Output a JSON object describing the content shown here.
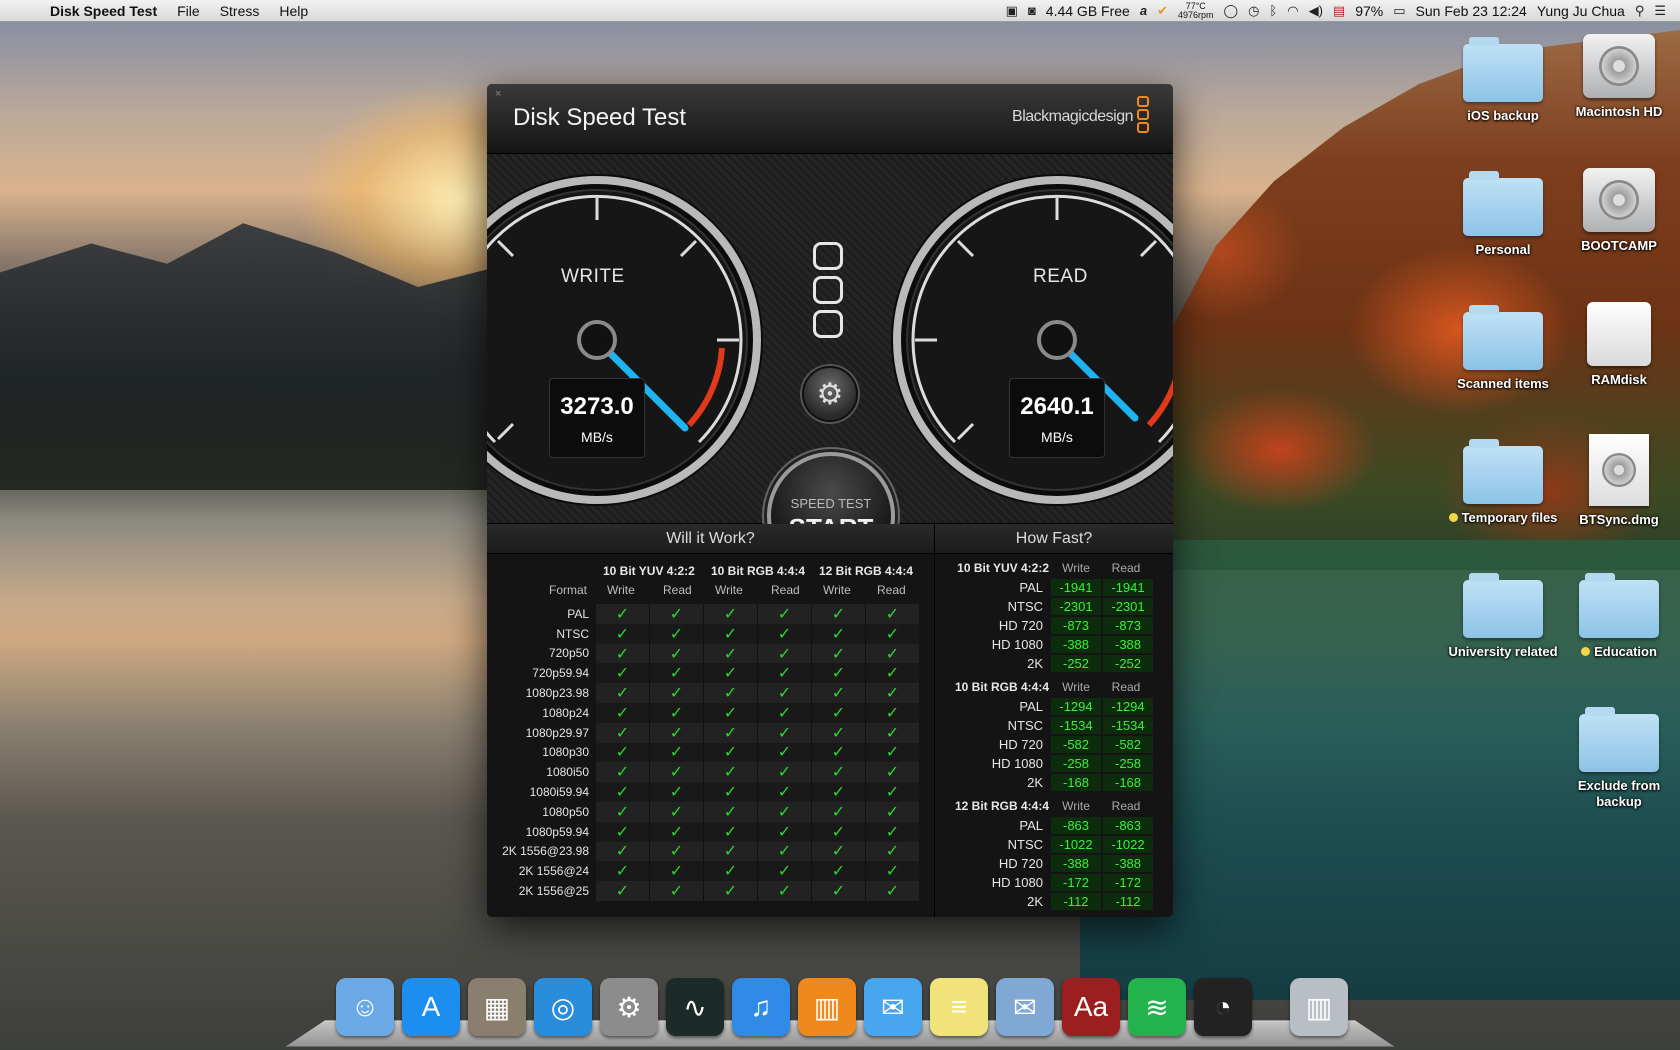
{
  "menubar": {
    "app_name": "Disk Speed Test",
    "menus": [
      "File",
      "Stress",
      "Help"
    ],
    "disk_free": "4.44 GB Free",
    "temp": "77°C",
    "rpm": "4976rpm",
    "battery": "97%",
    "datetime": "Sun Feb 23  12:24",
    "user": "Yung Ju Chua"
  },
  "desktop": {
    "items": [
      {
        "label": "iOS backup",
        "kind": "folder"
      },
      {
        "label": "Macintosh HD",
        "kind": "hdd"
      },
      {
        "label": "Personal",
        "kind": "folder"
      },
      {
        "label": "BOOTCAMP",
        "kind": "hdd"
      },
      {
        "label": "Scanned items",
        "kind": "folder"
      },
      {
        "label": "RAMdisk",
        "kind": "drive"
      },
      {
        "label": "Temporary files",
        "kind": "folder",
        "tag": "yellow"
      },
      {
        "label": "BTSync.dmg",
        "kind": "dmg"
      },
      {
        "label": "University related",
        "kind": "folder"
      },
      {
        "label": "Education",
        "kind": "folder",
        "tag": "yellow"
      },
      {
        "label": "Exclude from backup",
        "kind": "folder"
      }
    ]
  },
  "window": {
    "title": "Disk Speed Test",
    "brand": "Blackmagicdesign",
    "write": {
      "label": "WRITE",
      "value": "3273.0",
      "unit": "MB/s"
    },
    "read": {
      "label": "READ",
      "value": "2640.1",
      "unit": "MB/s"
    },
    "start": {
      "small": "SPEED TEST",
      "big": "START"
    },
    "will_it_work": {
      "title": "Will it Work?",
      "groups": [
        "10 Bit YUV 4:2:2",
        "10 Bit RGB 4:4:4",
        "12 Bit RGB 4:4:4"
      ],
      "format_header": "Format",
      "sub_write": "Write",
      "sub_read": "Read",
      "formats": [
        "PAL",
        "NTSC",
        "720p50",
        "720p59.94",
        "1080p23.98",
        "1080p24",
        "1080p29.97",
        "1080p30",
        "1080i50",
        "1080i59.94",
        "1080p50",
        "1080p59.94",
        "2K 1556@23.98",
        "2K 1556@24",
        "2K 1556@25"
      ],
      "check": "✓"
    },
    "how_fast": {
      "title": "How Fast?",
      "groups": [
        {
          "name": "10 Bit YUV 4:2:2",
          "rows": [
            {
              "fmt": "PAL",
              "w": "-1941",
              "r": "-1941"
            },
            {
              "fmt": "NTSC",
              "w": "-2301",
              "r": "-2301"
            },
            {
              "fmt": "HD 720",
              "w": "-873",
              "r": "-873"
            },
            {
              "fmt": "HD 1080",
              "w": "-388",
              "r": "-388"
            },
            {
              "fmt": "2K",
              "w": "-252",
              "r": "-252"
            }
          ]
        },
        {
          "name": "10 Bit RGB 4:4:4",
          "rows": [
            {
              "fmt": "PAL",
              "w": "-1294",
              "r": "-1294"
            },
            {
              "fmt": "NTSC",
              "w": "-1534",
              "r": "-1534"
            },
            {
              "fmt": "HD 720",
              "w": "-582",
              "r": "-582"
            },
            {
              "fmt": "HD 1080",
              "w": "-258",
              "r": "-258"
            },
            {
              "fmt": "2K",
              "w": "-168",
              "r": "-168"
            }
          ]
        },
        {
          "name": "12 Bit RGB 4:4:4",
          "rows": [
            {
              "fmt": "PAL",
              "w": "-863",
              "r": "-863"
            },
            {
              "fmt": "NTSC",
              "w": "-1022",
              "r": "-1022"
            },
            {
              "fmt": "HD 720",
              "w": "-388",
              "r": "-388"
            },
            {
              "fmt": "HD 1080",
              "w": "-172",
              "r": "-172"
            },
            {
              "fmt": "2K",
              "w": "-112",
              "r": "-112"
            }
          ]
        }
      ],
      "col_write": "Write",
      "col_read": "Read"
    }
  },
  "dock": {
    "icons": [
      "finder-icon",
      "app-store-icon",
      "preview-icon",
      "safari-icon",
      "system-preferences-icon",
      "activity-monitor-icon",
      "itunes-icon",
      "ibooks-icon",
      "messages-icon",
      "stickies-icon",
      "mail-icon",
      "dictionary-icon",
      "spotify-icon",
      "disk-speed-test-icon",
      "trash-icon"
    ]
  },
  "colors": {
    "needle": "#1fb3f0",
    "redline": "#e2391b",
    "check_green": "#2fd52f",
    "value_green": "#39f039",
    "brand_orange": "#f0891c"
  }
}
